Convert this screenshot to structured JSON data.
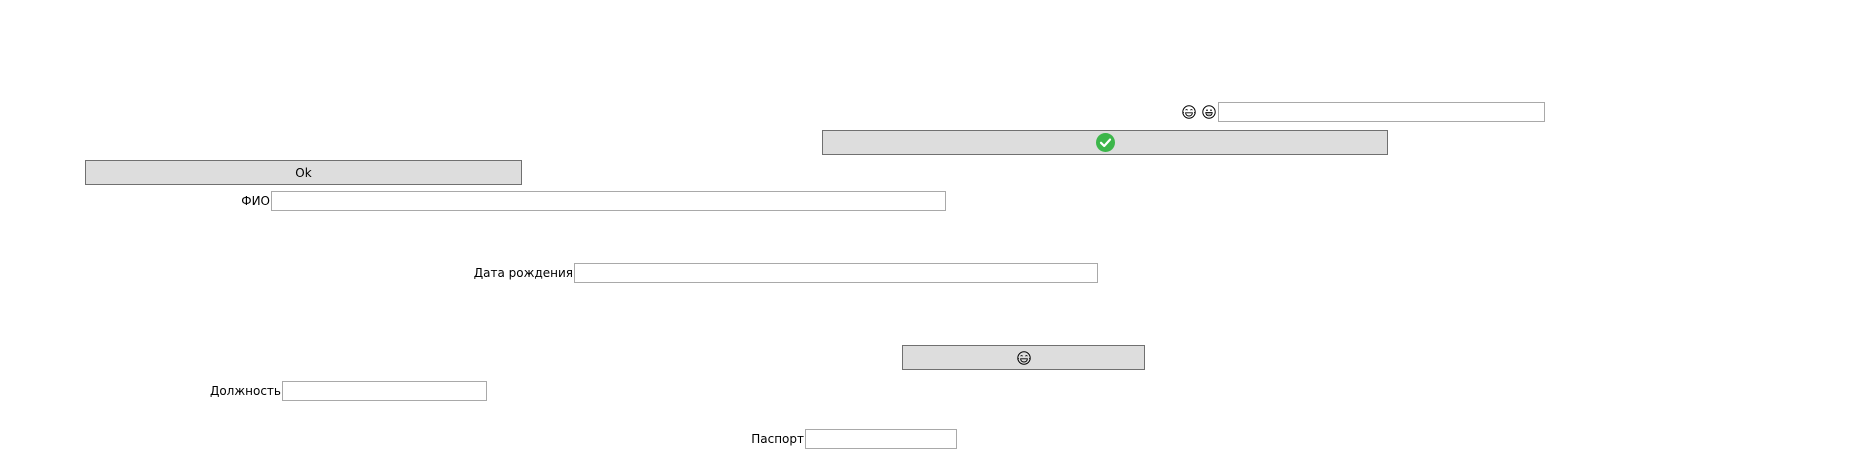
{
  "header_row": {
    "icons": [
      "grinning-tears-emoji-icon",
      "grinning-emoji-icon"
    ],
    "input_value": "",
    "input_placeholder": ""
  },
  "confirm_button": {
    "icon": "green-checkmark-icon",
    "accent_color": "#3cb64a"
  },
  "ok_button": {
    "label": "Ok"
  },
  "form": {
    "fio_label": "ФИО",
    "fio_value": "",
    "birth_label": "Дата рождения",
    "birth_value": "",
    "position_label": "Должность",
    "position_value": "",
    "passport_label": "Паспорт",
    "passport_value": ""
  },
  "emoji_button": {
    "icon": "grinning-tears-emoji-icon"
  }
}
